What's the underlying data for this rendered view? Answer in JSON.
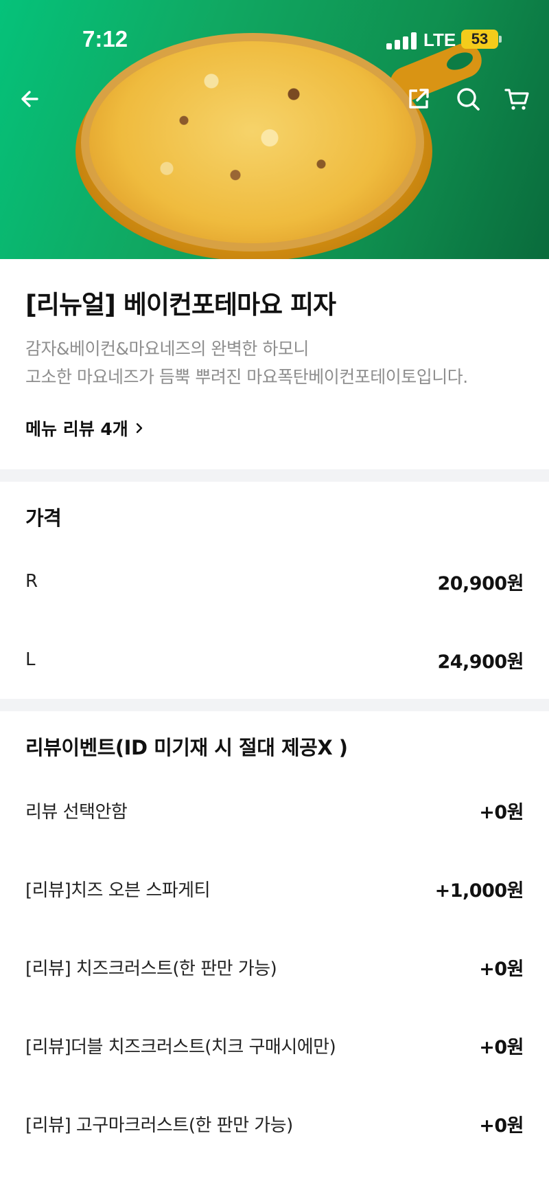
{
  "status_bar": {
    "time": "7:12",
    "network": "LTE",
    "battery": "53"
  },
  "header_icons": [
    "back-arrow-icon",
    "share-icon",
    "search-icon",
    "cart-icon"
  ],
  "product": {
    "title": "[리뉴얼] 베이컨포테마요 피자",
    "description_line1": "감자&베이컨&마요네즈의 완벽한 하모니",
    "description_line2": "고소한 마요네즈가 듬뿍 뿌려진 마요폭탄베이컨포테이토입니다.",
    "review_link": "메뉴 리뷰 4개"
  },
  "price_section": {
    "title": "가격",
    "options": [
      {
        "label": "R",
        "price": "20,900원"
      },
      {
        "label": "L",
        "price": "24,900원"
      }
    ]
  },
  "review_event_section": {
    "title": "리뷰이벤트(ID 미기재 시 절대 제공X )",
    "options": [
      {
        "label": "리뷰 선택안함",
        "price": "+0원"
      },
      {
        "label": "[리뷰]치즈 오븐 스파게티",
        "price": "+1,000원"
      },
      {
        "label": "[리뷰] 치즈크러스트(한 판만 가능)",
        "price": "+0원"
      },
      {
        "label": "[리뷰]더블 치즈크러스트(치크 구매시에만)",
        "price": "+0원"
      },
      {
        "label": "[리뷰] 고구마크러스트(한 판만 가능)",
        "price": "+0원"
      }
    ]
  },
  "colors": {
    "hero_green": "#10a862",
    "battery": "#f4cc1b",
    "divider": "#f2f3f5",
    "secondary_text": "#8e8e8e"
  }
}
